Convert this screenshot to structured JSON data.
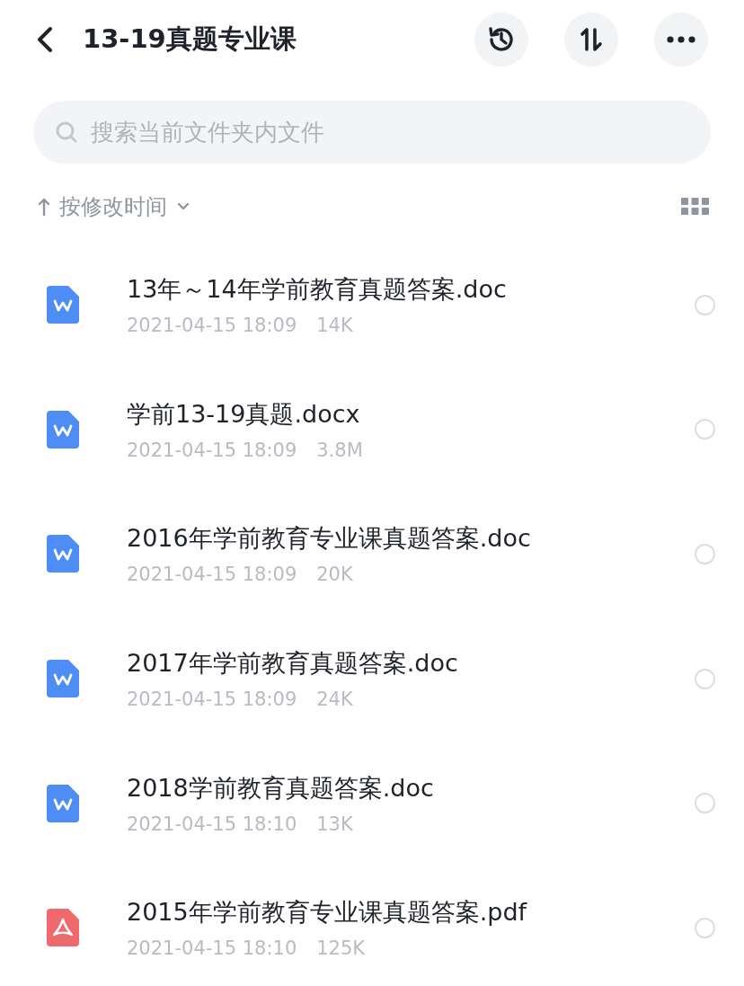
{
  "header": {
    "title": "13-19真题专业课"
  },
  "search": {
    "placeholder": "搜索当前文件夹内文件"
  },
  "sort": {
    "label": "按修改时间"
  },
  "files": [
    {
      "kind": "word",
      "name": "13年～14年学前教育真题答案.doc",
      "time": "2021-04-15 18:09",
      "size": "14K",
      "selected": false
    },
    {
      "kind": "word",
      "name": "学前13-19真题.docx",
      "time": "2021-04-15 18:09",
      "size": "3.8M",
      "selected": false
    },
    {
      "kind": "word",
      "name": "2016年学前教育专业课真题答案.doc",
      "time": "2021-04-15 18:09",
      "size": "20K",
      "selected": false
    },
    {
      "kind": "word",
      "name": "2017年学前教育真题答案.doc",
      "time": "2021-04-15 18:09",
      "size": "24K",
      "selected": false
    },
    {
      "kind": "word",
      "name": "2018学前教育真题答案.doc",
      "time": "2021-04-15 18:10",
      "size": "13K",
      "selected": false
    },
    {
      "kind": "pdf",
      "name": "2015年学前教育专业课真题答案.pdf",
      "time": "2021-04-15 18:10",
      "size": "125K",
      "selected": false
    }
  ]
}
